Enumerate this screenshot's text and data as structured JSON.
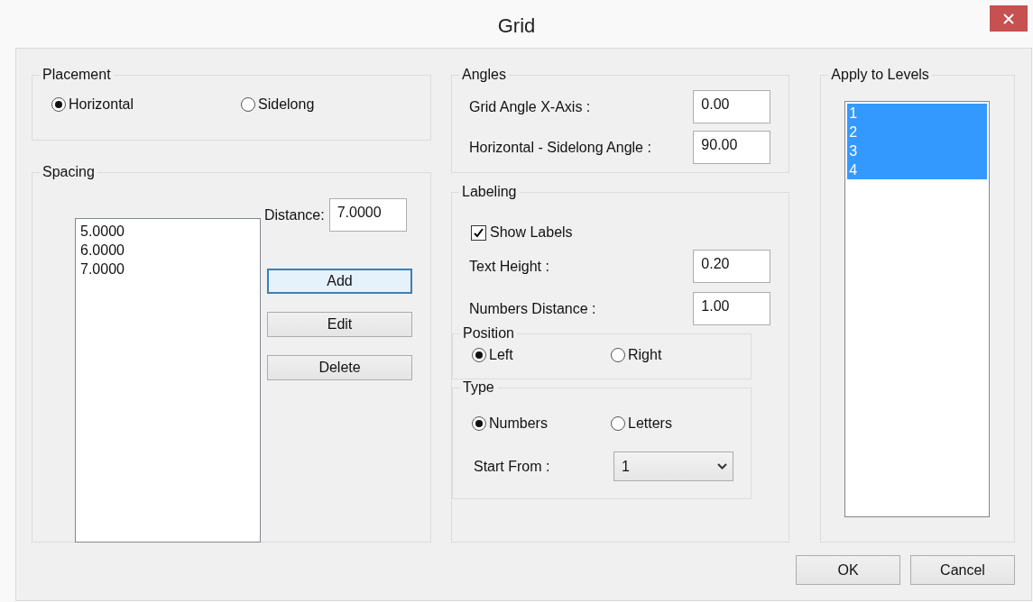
{
  "window": {
    "title": "Grid"
  },
  "placement": {
    "title": "Placement",
    "options": [
      {
        "label": "Horizontal",
        "selected": true
      },
      {
        "label": "Sidelong",
        "selected": false
      }
    ]
  },
  "spacing": {
    "title": "Spacing",
    "values": [
      "5.0000",
      "6.0000",
      "7.0000"
    ],
    "distance_label": "Distance:",
    "distance_value": "7.0000",
    "buttons": [
      {
        "label": "Add",
        "focused": true
      },
      {
        "label": "Edit",
        "focused": false
      },
      {
        "label": "Delete",
        "focused": false
      }
    ]
  },
  "angles": {
    "title": "Angles",
    "fields": [
      {
        "label": "Grid Angle X-Axis :",
        "value": "0.00"
      },
      {
        "label": "Horizontal - Sidelong Angle :",
        "value": "90.00"
      }
    ]
  },
  "labeling": {
    "title": "Labeling",
    "show_labels": {
      "label": "Show Labels",
      "checked": true
    },
    "fields": [
      {
        "label": "Text Height :",
        "value": "0.20"
      },
      {
        "label": "Numbers Distance :",
        "value": "1.00"
      }
    ],
    "position": {
      "title": "Position",
      "options": [
        {
          "label": "Left",
          "selected": true
        },
        {
          "label": "Right",
          "selected": false
        }
      ]
    },
    "type": {
      "title": "Type",
      "options": [
        {
          "label": "Numbers",
          "selected": true
        },
        {
          "label": "Letters",
          "selected": false
        }
      ],
      "start_from": {
        "label": "Start From :",
        "value": "1"
      }
    }
  },
  "levels": {
    "title": "Apply to Levels",
    "items": [
      {
        "label": "1",
        "selected": true
      },
      {
        "label": "2",
        "selected": true
      },
      {
        "label": "3",
        "selected": true
      },
      {
        "label": "4",
        "selected": true
      }
    ]
  },
  "buttons": [
    {
      "label": "OK"
    },
    {
      "label": "Cancel"
    }
  ]
}
